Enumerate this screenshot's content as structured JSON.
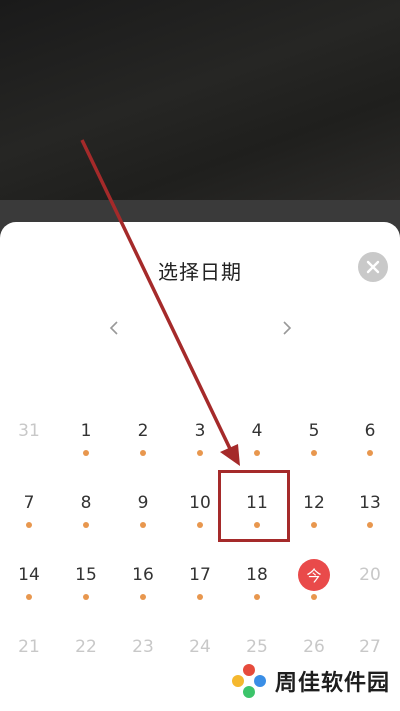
{
  "dialog": {
    "title": "选择日期",
    "close_icon": "close-icon",
    "prev_icon": "chevron-left-icon",
    "next_icon": "chevron-right-icon"
  },
  "calendar": {
    "weeks": [
      [
        {
          "label": "31",
          "muted": true,
          "dot": false
        },
        {
          "label": "1",
          "dot": true
        },
        {
          "label": "2",
          "dot": true
        },
        {
          "label": "3",
          "dot": true
        },
        {
          "label": "4",
          "dot": true
        },
        {
          "label": "5",
          "dot": true
        },
        {
          "label": "6",
          "dot": true
        }
      ],
      [
        {
          "label": "7",
          "dot": true
        },
        {
          "label": "8",
          "dot": true
        },
        {
          "label": "9",
          "dot": true
        },
        {
          "label": "10",
          "dot": true
        },
        {
          "label": "11",
          "dot": true,
          "highlighted": true
        },
        {
          "label": "12",
          "dot": true
        },
        {
          "label": "13",
          "dot": true
        }
      ],
      [
        {
          "label": "14",
          "dot": true
        },
        {
          "label": "15",
          "dot": true
        },
        {
          "label": "16",
          "dot": true
        },
        {
          "label": "17",
          "dot": true
        },
        {
          "label": "18",
          "dot": true
        },
        {
          "label": "今",
          "dot": true,
          "today": true
        },
        {
          "label": "20",
          "muted": true,
          "dot": false
        }
      ],
      [
        {
          "label": "21",
          "muted": true,
          "dot": false
        },
        {
          "label": "22",
          "muted": true,
          "dot": false
        },
        {
          "label": "23",
          "muted": true,
          "dot": false
        },
        {
          "label": "24",
          "muted": true,
          "dot": false
        },
        {
          "label": "25",
          "muted": true,
          "dot": false
        },
        {
          "label": "26",
          "muted": true,
          "dot": false
        },
        {
          "label": "27",
          "muted": true,
          "dot": false
        }
      ]
    ],
    "dot_color": "#e8974e",
    "today_color": "#e94a4a"
  },
  "annotation": {
    "arrow_color": "#a52a2a"
  },
  "watermark": {
    "text": "周佳软件园"
  }
}
